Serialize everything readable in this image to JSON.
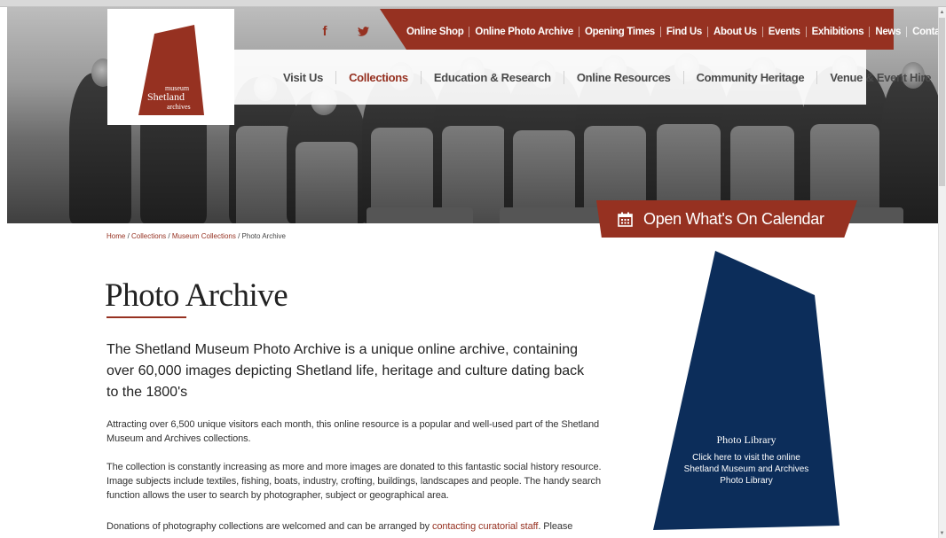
{
  "logo": {
    "line1": "museum",
    "line2": "Shetland",
    "line3": "archives"
  },
  "social": [
    {
      "name": "facebook",
      "glyph": "f"
    },
    {
      "name": "twitter",
      "glyph": "t"
    }
  ],
  "utility_nav": [
    "Online Shop",
    "Online Photo Archive",
    "Opening Times",
    "Find Us",
    "About Us",
    "Events",
    "Exhibitions",
    "News",
    "Contact"
  ],
  "main_nav": [
    "Visit Us",
    "Collections",
    "Education & Research",
    "Online Resources",
    "Community Heritage",
    "Venue & Event Hire"
  ],
  "main_nav_active": "Collections",
  "calendar_button": "Open What's On Calendar",
  "breadcrumb": {
    "home": "Home",
    "collections": "Collections",
    "museum_collections": "Museum Collections",
    "current": "Photo Archive",
    "sep": " / "
  },
  "page_title": "Photo Archive",
  "lead": "The Shetland Museum Photo Archive is a unique online archive, containing over 60,000 images depicting Shetland life, heritage and culture dating back to the 1800's",
  "paragraphs": {
    "p1": "Attracting over 6,500 unique visitors each month, this online resource is a popular and well-used part of the Shetland Museum and Archives collections.",
    "p2": "The collection is constantly increasing as more and more images are donated to this fantastic social history resource. Image subjects include textiles, fishing, boats, industry, crofting, buildings, landscapes and people. The handy search function allows the user to search by photographer, subject or geographical area.",
    "p3_start": "Donations of photography collections are welcomed and can be arranged by ",
    "p3_link": "contacting curatorial staff",
    "p3_end": ". Please"
  },
  "library": {
    "title": "Photo Library",
    "description": "Click here to visit the online Shetland Museum and Archives Photo Library"
  },
  "colors": {
    "brand_red": "#963121",
    "navy": "#0c2d5a",
    "text": "#222222"
  },
  "icons": {
    "calendar": "calendar-icon",
    "facebook": "facebook-icon",
    "twitter": "twitter-icon"
  }
}
